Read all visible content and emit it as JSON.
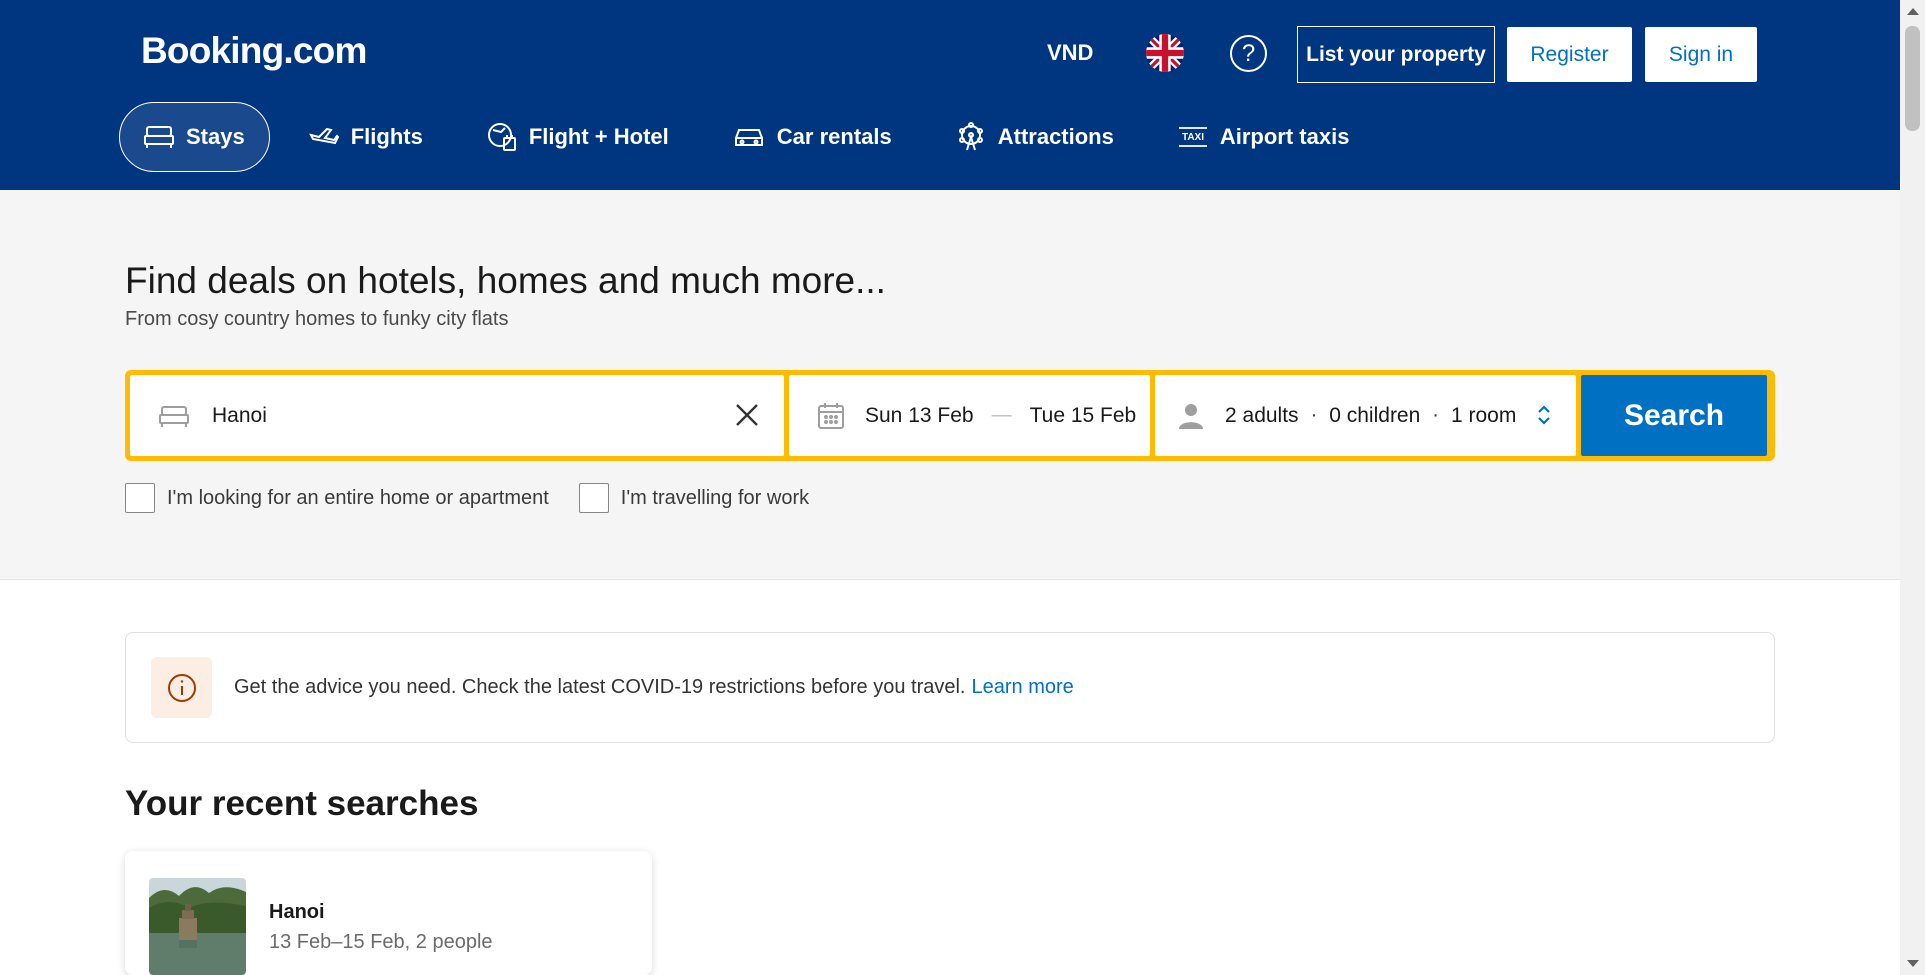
{
  "header": {
    "logo": "Booking.com",
    "currency": "VND",
    "help_icon": "?",
    "list_property_label": "List your property",
    "register_label": "Register",
    "signin_label": "Sign in"
  },
  "nav": {
    "items": [
      {
        "label": "Stays",
        "icon": "bed-icon",
        "active": true
      },
      {
        "label": "Flights",
        "icon": "plane-icon"
      },
      {
        "label": "Flight + Hotel",
        "icon": "flight-hotel-icon"
      },
      {
        "label": "Car rentals",
        "icon": "car-icon"
      },
      {
        "label": "Attractions",
        "icon": "ferris-wheel-icon"
      },
      {
        "label": "Airport taxis",
        "icon": "taxi-icon"
      }
    ]
  },
  "hero": {
    "title": "Find deals on hotels, homes and much more...",
    "subtitle": "From cosy country homes to funky city flats"
  },
  "search": {
    "destination": "Hanoi",
    "checkin": "Sun 13 Feb",
    "date_separator": "—",
    "checkout": "Tue 15 Feb",
    "adults": "2 adults",
    "children": "0 children",
    "rooms": "1 room",
    "dot": "·",
    "button_label": "Search"
  },
  "options": {
    "entire_home": "I'm looking for an entire home or apartment",
    "work_travel": "I'm travelling for work"
  },
  "banner": {
    "text": "Get the advice you need. Check the latest COVID-19 restrictions before you travel.",
    "link": "Learn more"
  },
  "recent": {
    "title": "Your recent searches",
    "items": [
      {
        "city": "Hanoi",
        "detail": "13 Feb–15 Feb, 2 people"
      }
    ]
  },
  "colors": {
    "brand": "#003580",
    "accent": "#0071c2",
    "highlight": "#febb02"
  }
}
